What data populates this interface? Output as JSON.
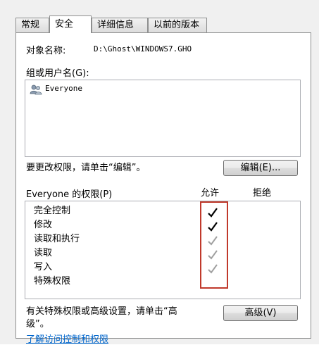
{
  "tabs": [
    {
      "label": "常规"
    },
    {
      "label": "安全",
      "active": true
    },
    {
      "label": "详细信息"
    },
    {
      "label": "以前的版本"
    }
  ],
  "object": {
    "label": "对象名称:",
    "value": "D:\\Ghost\\WINDOWS7.GHO"
  },
  "groups": {
    "label": "组或用户名(G):",
    "items": [
      {
        "name": "Everyone",
        "icon": "users-icon"
      }
    ]
  },
  "edit_hint": "要更改权限，请单击“编辑”。",
  "edit_button": "编辑(E)...",
  "permissions": {
    "header": "Everyone 的权限(P)",
    "allow_header": "允许",
    "deny_header": "拒绝",
    "rows": [
      {
        "label": "完全控制",
        "allow": "checked"
      },
      {
        "label": "修改",
        "allow": "checked"
      },
      {
        "label": "读取和执行",
        "allow": "grayed"
      },
      {
        "label": "读取",
        "allow": "grayed"
      },
      {
        "label": "写入",
        "allow": "grayed"
      },
      {
        "label": "特殊权限",
        "allow": "none"
      }
    ],
    "highlight_color": "#c0392b"
  },
  "advanced_hint_line1": "有关特殊权限或高级设置，请单击“高",
  "advanced_hint_line2": "级”。",
  "advanced_button": "高级(V)",
  "footer_link": "了解访问控制和权限",
  "colors": {
    "check_dark": "#000000",
    "check_gray": "#a0a0a0",
    "link": "#0066cc"
  }
}
